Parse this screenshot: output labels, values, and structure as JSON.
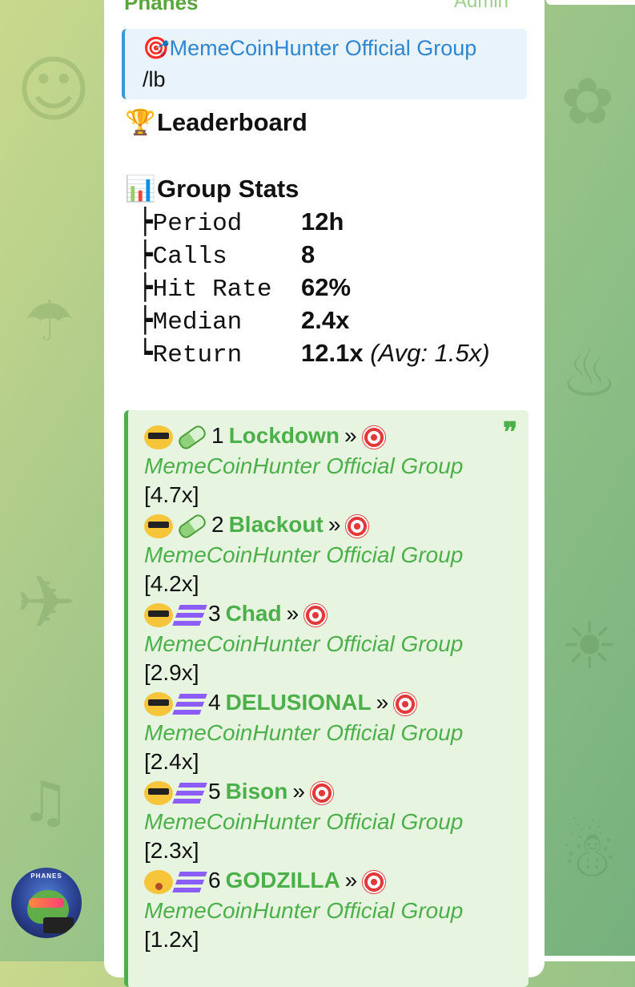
{
  "chat": {
    "sender": "Phanes",
    "sender_badge": "Admin",
    "avatar_text": "PHANES",
    "reply": {
      "title_emoji": "🎯",
      "title": "MemeCoinHunter Official Group",
      "text": "/lb"
    },
    "leaderboard_emoji": "🏆",
    "leaderboard_title": "Leaderboard",
    "stats_emoji": "📊",
    "stats_title": "Group Stats",
    "stats": [
      {
        "label": "┝Period   ",
        "value": "12h",
        "extra": ""
      },
      {
        "label": "┝Calls    ",
        "value": "8",
        "extra": ""
      },
      {
        "label": "┝Hit Rate ",
        "value": "62%",
        "extra": ""
      },
      {
        "label": "┝Median   ",
        "value": "2.4x",
        "extra": ""
      },
      {
        "label": "┕Return   ",
        "value": "12.1x ",
        "extra": "(Avg: 1.5x)"
      }
    ],
    "quote_icon": "❞",
    "entries": [
      {
        "rank": "1",
        "name": "Lockdown",
        "sep": "»",
        "group": "MemeCoinHunter Official Group",
        "mult": "[4.7x]",
        "face": "sunglasses-face-icon",
        "chain": "pill-icon"
      },
      {
        "rank": "2",
        "name": "Blackout",
        "sep": "»",
        "group": "MemeCoinHunter Official Group",
        "mult": "[4.2x]",
        "face": "sunglasses-face-icon",
        "chain": "pill-icon"
      },
      {
        "rank": "3",
        "name": "Chad",
        "sep": "»",
        "group": "MemeCoinHunter Official Group",
        "mult": "[2.9x]",
        "face": "sunglasses-face-icon",
        "chain": "solana-icon"
      },
      {
        "rank": "4",
        "name": "DELUSIONAL",
        "sep": "»",
        "group": "MemeCoinHunter Official Group",
        "mult": "[2.4x]",
        "face": "sunglasses-face-icon",
        "chain": "solana-icon"
      },
      {
        "rank": "5",
        "name": "Bison",
        "sep": "»",
        "group": "MemeCoinHunter Official Group",
        "mult": "[2.3x]",
        "face": "sunglasses-face-icon",
        "chain": "solana-icon"
      },
      {
        "rank": "6",
        "name": "GODZILLA",
        "sep": "»",
        "group": "MemeCoinHunter Official Group",
        "mult": "[1.2x]",
        "face": "yawning-face-icon",
        "chain": "solana-icon"
      }
    ]
  },
  "colors": {
    "accent_green": "#4cb04a",
    "link_blue": "#2f86d0",
    "quote_bg": "#e6f4e0"
  }
}
